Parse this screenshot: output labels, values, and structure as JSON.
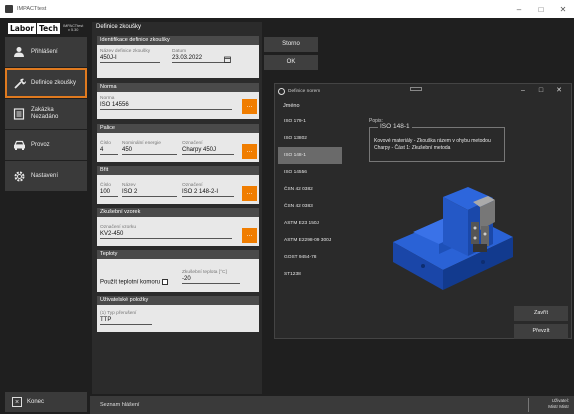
{
  "window": {
    "title": "IMPACTtest",
    "minimize": "–",
    "maximize": "□",
    "close": "✕"
  },
  "logo": {
    "labor": "Labor",
    "tech": "Tech",
    "product": "IMPACTtest",
    "version": "v 5.30"
  },
  "sidebar": {
    "items": [
      {
        "label": "Přihlášení",
        "icon": "user-icon"
      },
      {
        "label": "Definice zkoušky",
        "icon": "wrench-icon"
      },
      {
        "label_line1": "Zakázka",
        "label_line2": "Nezadáno",
        "icon": "document-icon"
      },
      {
        "label": "Provoz",
        "icon": "car-icon"
      },
      {
        "label": "Nastavení",
        "icon": "gear-icon"
      }
    ],
    "exit_label": "Konec"
  },
  "form": {
    "title": "Definice zkoušky",
    "identifikace": {
      "header": "Identifikace definice zkoušky",
      "name_label": "Název definice zkoušky",
      "name_value": "450J-I",
      "date_label": "Datum",
      "date_value": "23.03.2022"
    },
    "norma": {
      "header": "Norma",
      "label": "Norma",
      "value": "ISO 14556"
    },
    "palice": {
      "header": "Palice",
      "cislo_label": "Číslo",
      "cislo_value": "4",
      "energie_label": "Nominální energie",
      "energie_value": "450",
      "oznaceni_label": "Označení",
      "oznaceni_value": "Charpy 450J"
    },
    "brit": {
      "header": "Břit",
      "cislo_label": "Číslo",
      "cislo_value": "100",
      "nazev_label": "Název",
      "nazev_value": "ISO 2",
      "oznaceni_label": "Označení",
      "oznaceni_value": "ISO 2 148-2-I"
    },
    "vzorek": {
      "header": "Zkušební vzorek",
      "label": "Označení vzorku",
      "value": "KV2-450"
    },
    "teploty": {
      "header": "Teploty",
      "use_label": "Použít teplotní komoru",
      "temp_label": "Zkušební teplota [°C]",
      "temp_value": "-20"
    },
    "uzivatelske": {
      "header": "Uživatelské položky",
      "label": "(1) Typ přerušení",
      "value": "TTP"
    },
    "ellipsis": "..."
  },
  "buttons": {
    "storno": "Storno",
    "ok": "OK"
  },
  "dialog": {
    "title": "Definice norem",
    "list_header": "Jméno",
    "items": [
      "ISO 179-1",
      "ISO 13802",
      "ISO 148-1",
      "ISO 14556",
      "ČSN 42 0382",
      "ČSN 42 0383",
      "ASTM E23 150J",
      "ASTM E2298-09 300J",
      "GOST 9454-78",
      "ST1238"
    ],
    "selected_index": 2,
    "popis_label": "Popis:",
    "popis_legend": "ISO 148-1",
    "popis_text": "Kovové materiály - Zkouška rázem v ohybu metodou Charpy - Část 1: Zkušební metoda",
    "zavrit": "Zavřít",
    "prevzit": "Převzít"
  },
  "status": {
    "text": "Seznam hlášení",
    "user_label": "Uživatel:",
    "user_value": "Mistr",
    "user_value2": "Mistr"
  },
  "colors": {
    "accent": "#f07d00",
    "background": "#1f1f1f",
    "panel": "#2b2b2b",
    "machine": "#1d4fb5"
  }
}
